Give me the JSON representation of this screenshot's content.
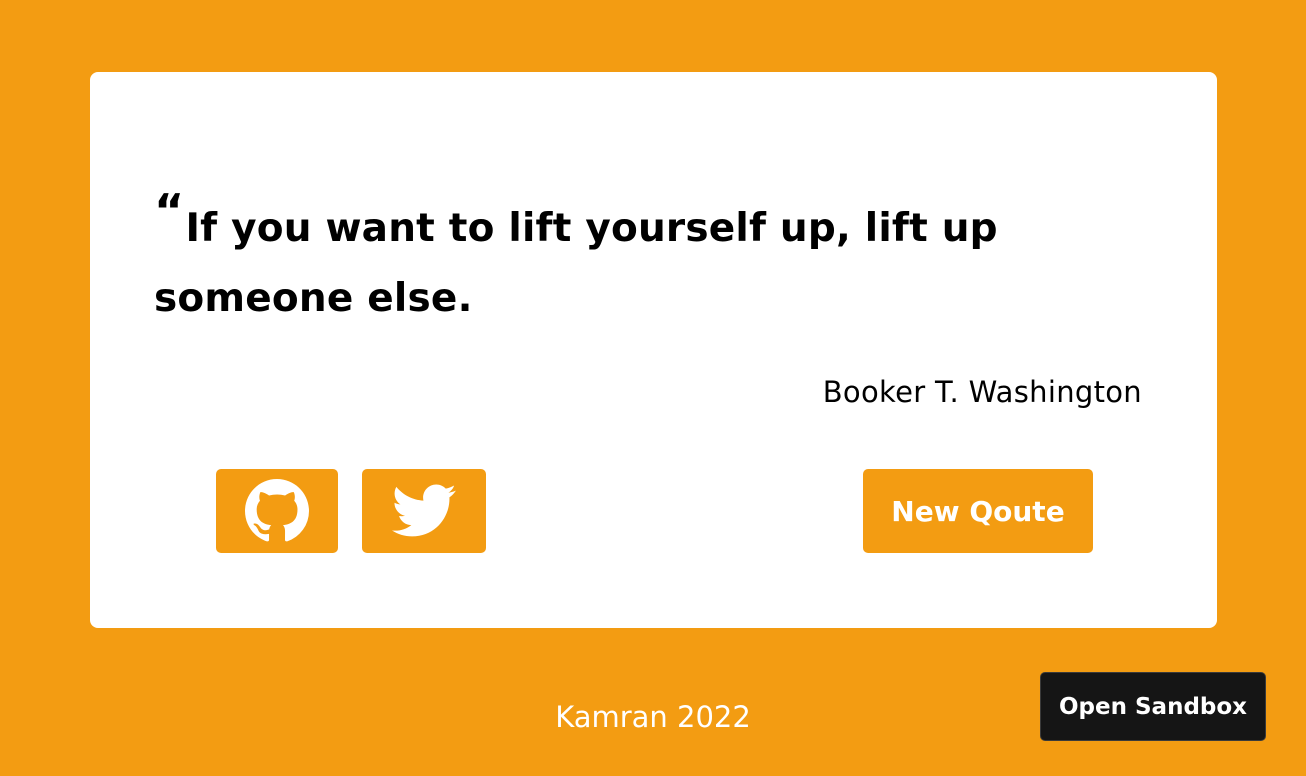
{
  "quote": {
    "mark": "“",
    "text": "If you want to lift yourself up, lift up someone else.",
    "author": "Booker T. Washington"
  },
  "actions": {
    "github_icon": "github-icon",
    "twitter_icon": "twitter-icon",
    "new_quote_label": "New Qoute"
  },
  "footer": {
    "text": "Kamran 2022"
  },
  "sandbox": {
    "label": "Open Sandbox"
  },
  "colors": {
    "background": "#f39c12",
    "card": "#ffffff",
    "text": "#000000",
    "sandbox_button": "#151515"
  }
}
